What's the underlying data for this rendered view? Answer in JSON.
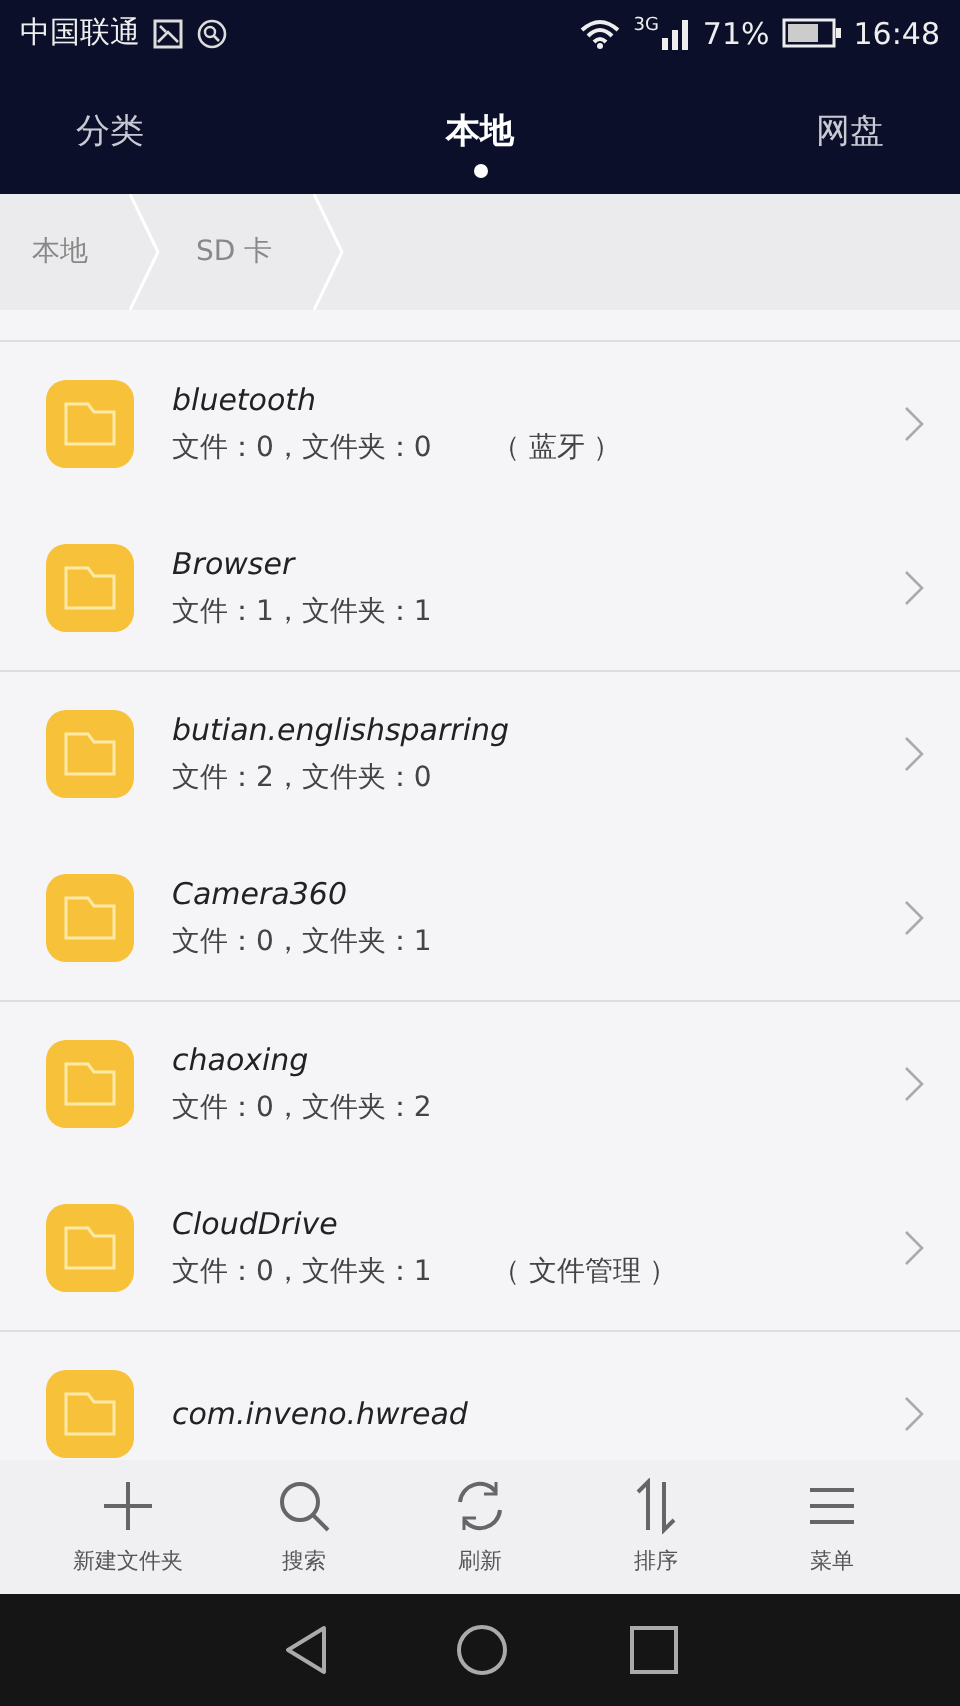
{
  "status_bar": {
    "carrier": "中国联通",
    "network": "3G",
    "battery": "71%",
    "time": "16:48"
  },
  "tabs": [
    {
      "label": "分类",
      "selected": false
    },
    {
      "label": "本地",
      "selected": true
    },
    {
      "label": "网盘",
      "selected": false
    }
  ],
  "breadcrumb": [
    "本地",
    "SD 卡"
  ],
  "groups": [
    [
      {
        "name": "bluetooth",
        "details": "文件：0，文件夹：0",
        "note": "（ 蓝牙 ）"
      },
      {
        "name": "Browser",
        "details": "文件：1，文件夹：1"
      }
    ],
    [
      {
        "name": "butian.englishsparring",
        "details": "文件：2，文件夹：0"
      },
      {
        "name": "Camera360",
        "details": "文件：0，文件夹：1"
      }
    ],
    [
      {
        "name": "chaoxing",
        "details": "文件：0，文件夹：2"
      },
      {
        "name": "CloudDrive",
        "details": "文件：0，文件夹：1",
        "note": "（ 文件管理 ）"
      }
    ],
    [
      {
        "name": "com.inveno.hwread"
      }
    ]
  ],
  "toolbar": [
    {
      "kind": "add",
      "label": "新建文件夹"
    },
    {
      "kind": "search",
      "label": "搜索"
    },
    {
      "kind": "refresh",
      "label": "刷新"
    },
    {
      "kind": "sort",
      "label": "排序"
    },
    {
      "kind": "menu",
      "label": "菜单"
    }
  ]
}
